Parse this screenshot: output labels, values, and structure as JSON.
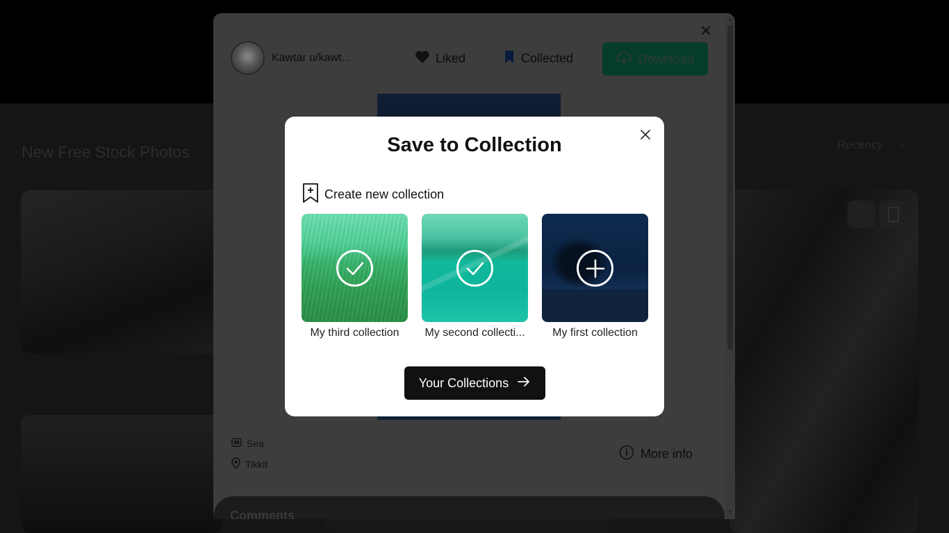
{
  "background": {
    "section_title": "New Free Stock Photos",
    "sort_label": "Recency"
  },
  "photo_modal": {
    "username": "Kawtar u/kawt...",
    "liked_label": "Liked",
    "collected_label": "Collected",
    "download_label": "Download",
    "tag": "Sea",
    "location": "Tikkit",
    "more_info_label": "More info",
    "comments_title": "Comments"
  },
  "dialog": {
    "title": "Save to Collection",
    "create_label": "Create new collection",
    "collections": [
      {
        "label": "My third collection",
        "state": "selected",
        "icon": "check-icon"
      },
      {
        "label": "My second collecti...",
        "state": "selected",
        "icon": "check-icon"
      },
      {
        "label": "My first collection",
        "state": "not-selected",
        "icon": "plus-icon"
      }
    ],
    "your_collections_label": "Your Collections"
  },
  "colors": {
    "download_button": "#063d2a",
    "selected_overlay": "#4fd6a0",
    "primary_button": "#111111"
  }
}
